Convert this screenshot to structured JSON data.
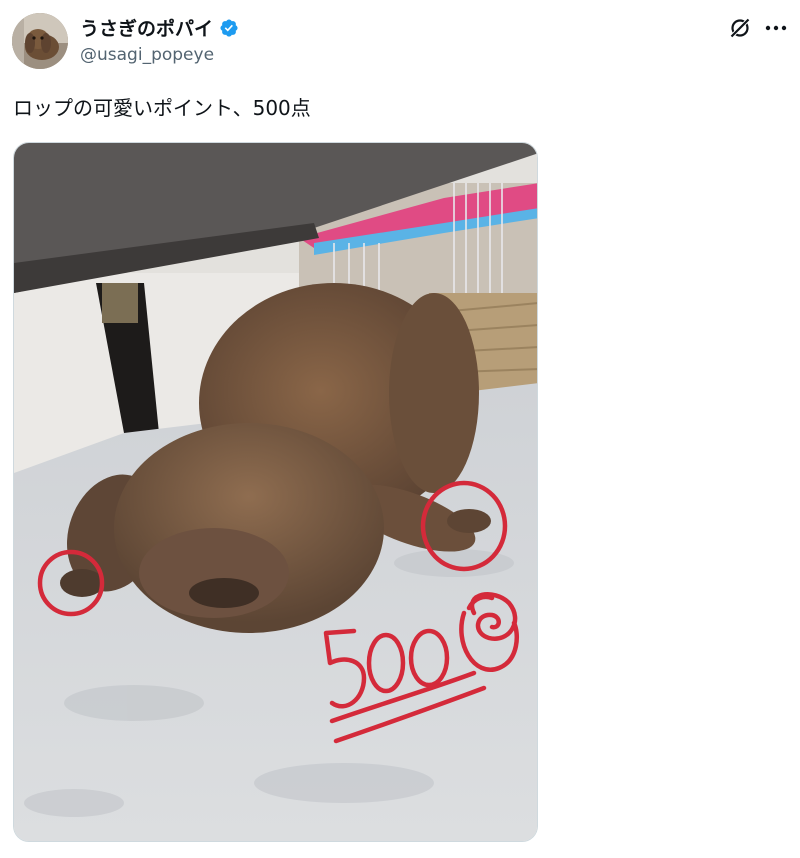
{
  "author": {
    "display_name": "うさぎのポパイ",
    "handle": "@usagi_popeye",
    "verified_icon": "verified-badge-icon",
    "avatar_icon": "rabbit-avatar"
  },
  "header_actions": {
    "grok_icon": "grok-icon",
    "more_icon": "more-dots-icon"
  },
  "tweet": {
    "text": "ロップの可愛いポイント、500点"
  },
  "media": {
    "description_icon": "rabbit-photo",
    "annotation_score": "500",
    "annotation_color": "#d42a3a"
  },
  "colors": {
    "accent": "#1d9bf0",
    "text_primary": "#0f1419",
    "text_secondary": "#536471",
    "annotation_red": "#d42a3a"
  }
}
